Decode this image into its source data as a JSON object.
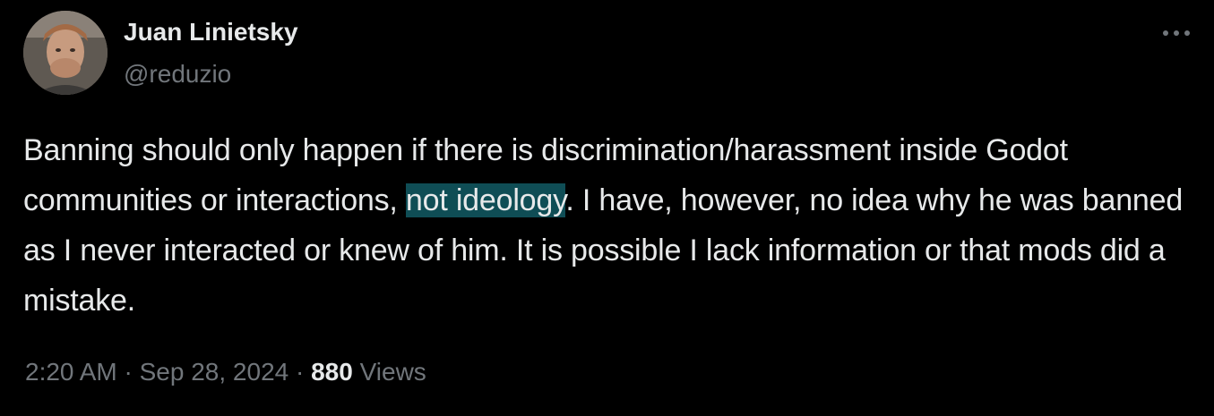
{
  "author": {
    "display_name": "Juan Linietsky",
    "handle": "@reduzio",
    "avatar_icon": "user-avatar-photo"
  },
  "menu": {
    "icon": "more-horizontal-icon"
  },
  "tweet": {
    "text_part1": "Banning should only happen if there is discrimination/harassment inside Godot communities or interactions, ",
    "highlighted": "not ideology",
    "text_part2": ". I have, however, no idea why he was banned as I never interacted or knew of him. It is possible I lack information or that mods did a mistake."
  },
  "meta": {
    "time": "2:20 AM",
    "separator": " · ",
    "date": "Sep 28, 2024",
    "views_count": "880",
    "views_label": " Views"
  },
  "colors": {
    "background": "#000000",
    "primary_text": "#e7e9ea",
    "secondary_text": "#71767b",
    "highlight": "#0f4d55"
  }
}
